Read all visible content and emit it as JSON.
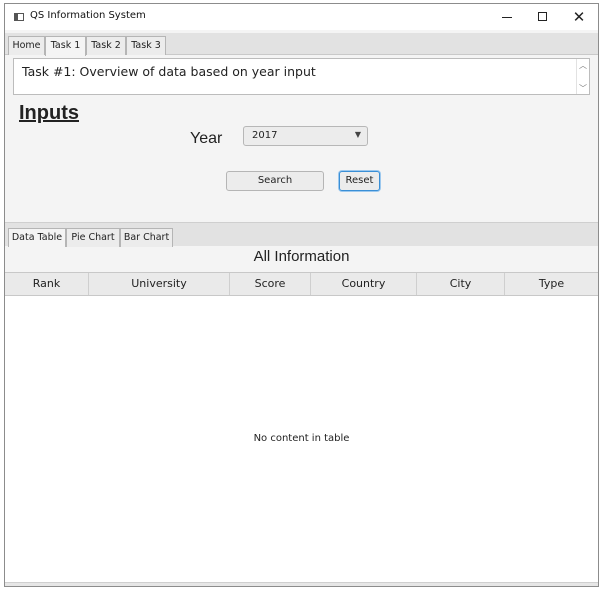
{
  "window": {
    "title": "QS Information System",
    "minimize": "–",
    "maximize": "",
    "close": "✕"
  },
  "tabs": [
    {
      "label": "Home",
      "active": false
    },
    {
      "label": "Task 1",
      "active": true
    },
    {
      "label": "Task 2",
      "active": false
    },
    {
      "label": "Task 3",
      "active": false
    }
  ],
  "description": "Task #1: Overview of data based on year input",
  "inputs": {
    "heading": "Inputs",
    "year_label": "Year",
    "year_value": "2017",
    "search_label": "Search",
    "reset_label": "Reset"
  },
  "sub_tabs": [
    {
      "label": "Data Table",
      "active": true
    },
    {
      "label": "Pie Chart",
      "active": false
    },
    {
      "label": "Bar Chart",
      "active": false
    }
  ],
  "table": {
    "title": "All Information",
    "columns": [
      "Rank",
      "University",
      "Score",
      "Country",
      "City",
      "Type"
    ],
    "empty_message": "No content in table"
  },
  "colors": {
    "focus_accent": "#3a8fd6"
  }
}
